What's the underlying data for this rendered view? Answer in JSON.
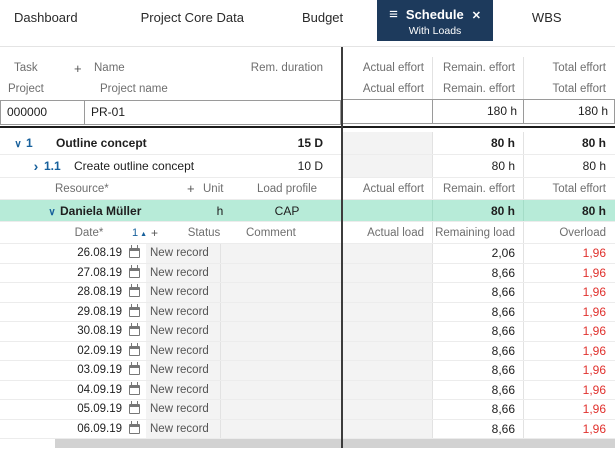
{
  "colors": {
    "active_tab": "#1d3a5c",
    "highlight_green": "#b7ebd8",
    "overload_red": "#e0312d",
    "accent_blue": "#17609c"
  },
  "tabs": {
    "dashboard": "Dashboard",
    "project_core_data": "Project Core Data",
    "budget": "Budget",
    "schedule": "Schedule",
    "schedule_sub": "With Loads",
    "wbs": "WBS"
  },
  "main_header": {
    "task": "Task",
    "add": "+",
    "name": "Name",
    "rem_duration": "Rem. duration",
    "actual_effort": "Actual effort",
    "remain_effort": "Remain. effort",
    "total_effort": "Total effort"
  },
  "project_header": {
    "project": "Project",
    "project_name": "Project name",
    "actual_effort": "Actual effort",
    "remain_effort": "Remain. effort",
    "total_effort": "Total effort"
  },
  "project": {
    "id": "000000",
    "name": "PR-01",
    "actual": "",
    "remain": "180 h",
    "total": "180 h"
  },
  "tasks": [
    {
      "num": "1",
      "name": "Outline concept",
      "duration": "15 D",
      "actual": "",
      "remain": "80 h",
      "total": "80 h"
    },
    {
      "num": "1.1",
      "name": "Create outline concept",
      "duration": "10 D",
      "actual": "",
      "remain": "80 h",
      "total": "80 h"
    }
  ],
  "resource_header": {
    "resource": "Resource*",
    "add": "+",
    "unit": "Unit",
    "load_profile": "Load profile",
    "actual_effort": "Actual effort",
    "remain_effort": "Remain. effort",
    "total_effort": "Total effort"
  },
  "resource": {
    "name": "Daniela Müller",
    "unit": "h",
    "load_profile": "CAP",
    "actual": "",
    "remain": "80 h",
    "total": "80 h"
  },
  "load_header": {
    "date": "Date*",
    "sort_order": "1",
    "add": "+",
    "status": "Status",
    "comment": "Comment",
    "actual_load": "Actual load",
    "remaining_load": "Remaining load",
    "overload": "Overload"
  },
  "loads": [
    {
      "date": "26.08.19",
      "status": "New record",
      "comment": "",
      "actual": "",
      "remaining": "2,06",
      "overload": "1,96"
    },
    {
      "date": "27.08.19",
      "status": "New record",
      "comment": "",
      "actual": "",
      "remaining": "8,66",
      "overload": "1,96"
    },
    {
      "date": "28.08.19",
      "status": "New record",
      "comment": "",
      "actual": "",
      "remaining": "8,66",
      "overload": "1,96"
    },
    {
      "date": "29.08.19",
      "status": "New record",
      "comment": "",
      "actual": "",
      "remaining": "8,66",
      "overload": "1,96"
    },
    {
      "date": "30.08.19",
      "status": "New record",
      "comment": "",
      "actual": "",
      "remaining": "8,66",
      "overload": "1,96"
    },
    {
      "date": "02.09.19",
      "status": "New record",
      "comment": "",
      "actual": "",
      "remaining": "8,66",
      "overload": "1,96"
    },
    {
      "date": "03.09.19",
      "status": "New record",
      "comment": "",
      "actual": "",
      "remaining": "8,66",
      "overload": "1,96"
    },
    {
      "date": "04.09.19",
      "status": "New record",
      "comment": "",
      "actual": "",
      "remaining": "8,66",
      "overload": "1,96"
    },
    {
      "date": "05.09.19",
      "status": "New record",
      "comment": "",
      "actual": "",
      "remaining": "8,66",
      "overload": "1,96"
    },
    {
      "date": "06.09.19",
      "status": "New record",
      "comment": "",
      "actual": "",
      "remaining": "8,66",
      "overload": "1,96"
    }
  ]
}
